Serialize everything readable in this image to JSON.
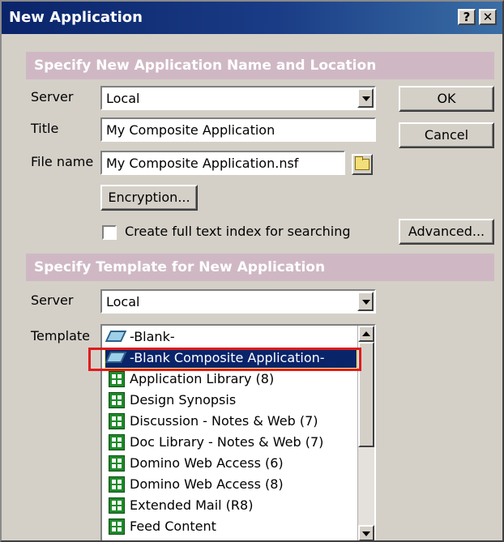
{
  "window": {
    "title": "New Application",
    "help_glyph": "?",
    "close_glyph": "✕"
  },
  "section1": {
    "heading": "Specify New Application Name and Location",
    "server_label": "Server",
    "server_value": "Local",
    "title_label": "Title",
    "title_value": "My Composite Application",
    "filename_label": "File name",
    "filename_value": "My Composite Application.nsf",
    "encryption_button": "Encryption...",
    "fulltext_checkbox_label": "Create full text index for searching",
    "fulltext_checked": false
  },
  "buttons": {
    "ok": "OK",
    "cancel": "Cancel",
    "advanced": "Advanced..."
  },
  "section2": {
    "heading": "Specify Template for New Application",
    "server_label": "Server",
    "server_value": "Local",
    "template_label": "Template"
  },
  "templates": [
    {
      "label": "-Blank-",
      "icon": "blank-template-icon",
      "selected": false
    },
    {
      "label": "-Blank Composite Application-",
      "icon": "blank-template-icon",
      "selected": true
    },
    {
      "label": "Application Library (8)",
      "icon": "template-icon",
      "selected": false
    },
    {
      "label": "Design Synopsis",
      "icon": "template-icon",
      "selected": false
    },
    {
      "label": "Discussion - Notes & Web (7)",
      "icon": "template-icon",
      "selected": false
    },
    {
      "label": "Doc Library - Notes & Web (7)",
      "icon": "template-icon",
      "selected": false
    },
    {
      "label": "Domino Web Access (6)",
      "icon": "template-icon",
      "selected": false
    },
    {
      "label": "Domino Web Access (8)",
      "icon": "template-icon",
      "selected": false
    },
    {
      "label": "Extended Mail (R8)",
      "icon": "template-icon",
      "selected": false
    },
    {
      "label": "Feed Content",
      "icon": "template-icon",
      "selected": false
    }
  ],
  "colors": {
    "titlebar": "#0a246a",
    "section_band": "#cfb8c4",
    "selection": "#0a246a",
    "highlight_box": "#e01b1b"
  }
}
